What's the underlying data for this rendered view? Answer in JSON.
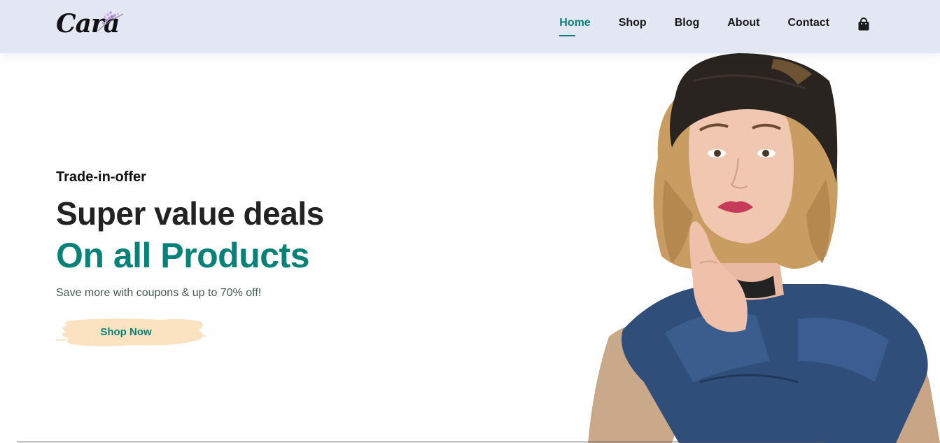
{
  "brand": {
    "logo_text": "Cara"
  },
  "nav": {
    "items": [
      {
        "label": "Home",
        "active": true
      },
      {
        "label": "Shop",
        "active": false
      },
      {
        "label": "Blog",
        "active": false
      },
      {
        "label": "About",
        "active": false
      },
      {
        "label": "Contact",
        "active": false
      }
    ],
    "cart_icon": "shopping-bag-icon"
  },
  "hero": {
    "eyebrow": "Trade-in-offer",
    "headline_1": "Super value deals",
    "headline_2": "On all Products",
    "subtext": "Save more with coupons & up to 70% off!",
    "button_label": "Shop Now"
  },
  "colors": {
    "accent": "#088178",
    "header_bg": "#e3e6f3",
    "button_bg": "#fbe3c1"
  }
}
